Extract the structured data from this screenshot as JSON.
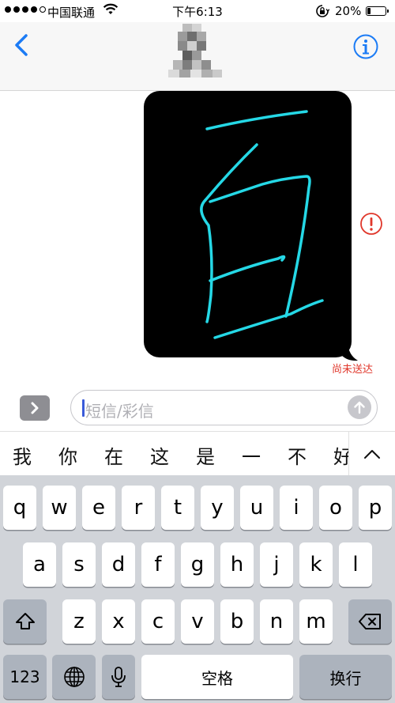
{
  "status_bar": {
    "carrier": "中国联通",
    "time": "下午6:13",
    "battery_percent": "20%",
    "battery_level": 0.2,
    "signal_dots": 4,
    "wifi": "wifi-icon",
    "orientation_lock": "orientation-lock-icon"
  },
  "nav": {
    "back_icon": "chevron-left-icon",
    "contact_avatar": "blurred-contact-avatar",
    "info_icon": "info-icon",
    "accent_color": "#1b7bf5"
  },
  "message": {
    "type": "handwriting",
    "ink_color": "#25d8e6",
    "background": "#000000",
    "error_icon": "exclamation-circle-icon",
    "error_color": "#e0372b",
    "status_text": "尚未送达"
  },
  "compose": {
    "expand_icon": "chevron-right-icon",
    "placeholder": "短信/彩信",
    "send_icon": "arrow-up-icon"
  },
  "candidates": {
    "items": [
      "我",
      "你",
      "在",
      "这",
      "是",
      "一",
      "不",
      "好"
    ],
    "toggle_icon": "chevron-up-icon"
  },
  "keyboard": {
    "row1": [
      "q",
      "w",
      "e",
      "r",
      "t",
      "y",
      "u",
      "i",
      "o",
      "p"
    ],
    "row2": [
      "a",
      "s",
      "d",
      "f",
      "g",
      "h",
      "j",
      "k",
      "l"
    ],
    "row3": [
      "z",
      "x",
      "c",
      "v",
      "b",
      "n",
      "m"
    ],
    "shift_icon": "shift-icon",
    "delete_icon": "delete-icon",
    "numbers_label": "123",
    "globe_icon": "globe-icon",
    "mic_icon": "microphone-icon",
    "space_label": "空格",
    "return_label": "换行"
  }
}
